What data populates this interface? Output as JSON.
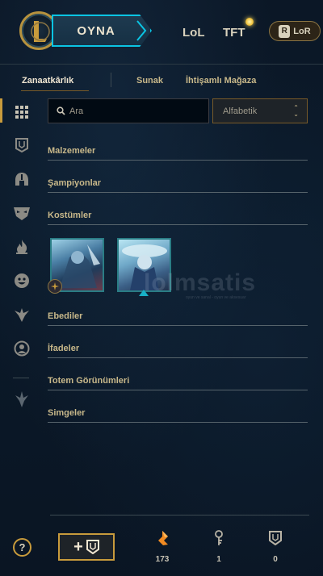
{
  "header": {
    "play_label": "OYNA",
    "nav_lol": "LoL",
    "nav_tft": "TFT",
    "lor_label": "LoR",
    "lor_icon_letter": "R",
    "logo_letter": "L"
  },
  "tabs": [
    {
      "label": "Zanaatkârlık",
      "active": true
    },
    {
      "label": "Sunak",
      "active": false
    },
    {
      "label": "İhtişamlı Mağaza",
      "active": false
    }
  ],
  "rail_icons": [
    "grid-icon",
    "chest-icon",
    "helmet-icon",
    "mask-icon",
    "flame-icon",
    "emote-icon",
    "ward-icon",
    "profile-icon",
    "totem-icon"
  ],
  "search": {
    "placeholder": "Ara",
    "value": ""
  },
  "sort": {
    "selected": "Alfabetik"
  },
  "sections": {
    "materials": "Malzemeler",
    "champions": "Şampiyonlar",
    "skins": "Kostümler",
    "eternals": "Ebediler",
    "emotes": "İfadeler",
    "totem_skins": "Totem Görünümleri",
    "icons": "Simgeler"
  },
  "skins_items": [
    {
      "name": "skin-1",
      "has_badge": true
    },
    {
      "name": "skin-2",
      "has_badge": false
    }
  ],
  "watermark": {
    "text": "lolmsatis",
    "sub": "oyun ve sanal - oyun ve aksesuar"
  },
  "footer": {
    "help_label": "?",
    "add_label": "+",
    "currencies": [
      {
        "icon": "orange-essence-icon",
        "value": "173"
      },
      {
        "icon": "key-icon",
        "value": "1"
      },
      {
        "icon": "chest-icon",
        "value": "0"
      }
    ]
  },
  "colors": {
    "gold": "#c89b3c",
    "teal": "#0bc4e3",
    "text": "#c8b88a"
  }
}
